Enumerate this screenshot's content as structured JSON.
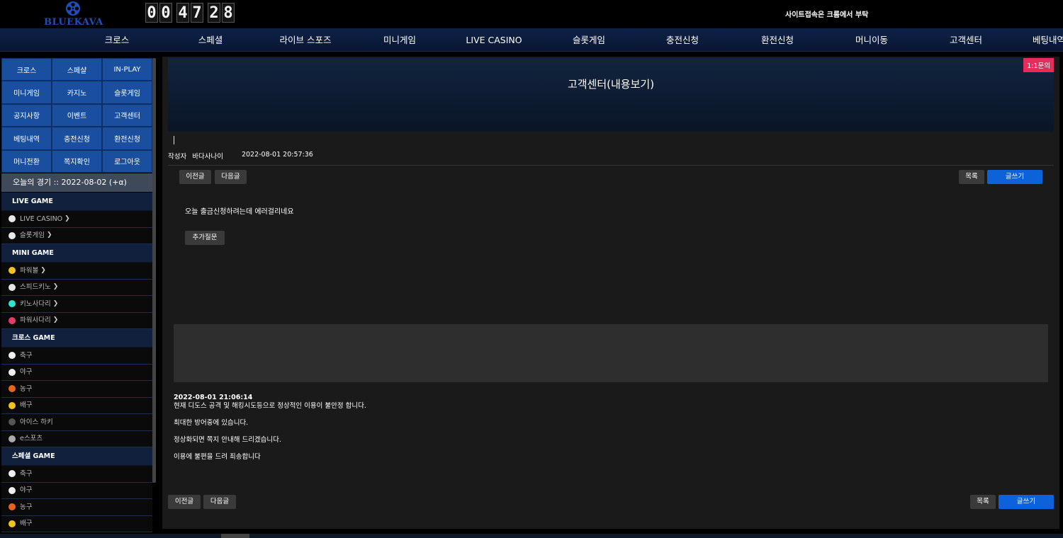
{
  "header": {
    "logo_text": "BLUEKAVA",
    "clock": {
      "hours": "00",
      "minutes": "47",
      "seconds": "28"
    },
    "ticker_text": "사이트접속은 크롬에서 부탁"
  },
  "nav": [
    "크로스",
    "스페셜",
    "라이브 스포즈",
    "미니게임",
    "LIVE CASINO",
    "슬롯게임",
    "충전신청",
    "환전신청",
    "머니이동",
    "고객센터",
    "베팅내역"
  ],
  "quick_menu": [
    "크로스",
    "스페샬",
    "IN-PLAY",
    "미니게임",
    "카지노",
    "슬롯게임",
    "공지사항",
    "이벤트",
    "고객센터",
    "베팅내역",
    "충전신청",
    "환전신청",
    "머니전환",
    "쪽지확인",
    "로그아웃"
  ],
  "today_match": "오늘의 경기 :: 2022-08-02 (+α)",
  "sidebar_sections": [
    {
      "header": "LIVE GAME",
      "items": [
        {
          "label": "LIVE CASINO",
          "icon": "casino-icon",
          "color": "#e9e9e9",
          "chevron": true
        },
        {
          "label": "슬롯게임",
          "icon": "slot-icon",
          "color": "#e9e9e9",
          "chevron": true
        }
      ]
    },
    {
      "header": "MINI GAME",
      "items": [
        {
          "label": "파워볼",
          "icon": "powerball-icon",
          "color": "#f2c31c",
          "chevron": true
        },
        {
          "label": "스피드키노",
          "icon": "speedkeno-icon",
          "color": "#e6e6e6",
          "chevron": true
        },
        {
          "label": "키노사다리",
          "icon": "kenoladder-icon",
          "color": "#2ee6c8",
          "chevron": true
        },
        {
          "label": "파워사다리",
          "icon": "powerladder-icon",
          "color": "#e63a6a",
          "chevron": true
        }
      ]
    },
    {
      "header": "크로스 GAME",
      "items": [
        {
          "label": "축구",
          "icon": "soccer-icon",
          "color": "#f0f0f0"
        },
        {
          "label": "야구",
          "icon": "baseball-icon",
          "color": "#f0f0f0"
        },
        {
          "label": "농구",
          "icon": "basketball-icon",
          "color": "#e8641c"
        },
        {
          "label": "배구",
          "icon": "volleyball-icon",
          "color": "#f2c31c"
        },
        {
          "label": "아이스 하키",
          "icon": "hockey-icon",
          "color": "#555555"
        },
        {
          "label": "e스포츠",
          "icon": "esports-icon",
          "color": "#aaaaaa"
        }
      ]
    },
    {
      "header": "스페셜 GAME",
      "items": [
        {
          "label": "축구",
          "icon": "soccer-icon",
          "color": "#f0f0f0"
        },
        {
          "label": "야구",
          "icon": "baseball-icon",
          "color": "#f0f0f0"
        },
        {
          "label": "농구",
          "icon": "basketball-icon",
          "color": "#e8641c"
        },
        {
          "label": "배구",
          "icon": "volleyball-icon",
          "color": "#f2c31c"
        }
      ]
    }
  ],
  "main": {
    "title": "고객센터(내용보기)",
    "qna_badge": "1:1문의",
    "author_label": "작성자",
    "author": "바다사나이",
    "posted_at": "2022-08-01 20:57:36",
    "prev_label": "이전글",
    "next_label": "다음글",
    "list_label": "목록",
    "write_label": "글쓰기",
    "content": "오늘 출금신청하려는데 에러걸리네요",
    "followup_label": "추가질문",
    "answer_date": "2022-08-01 21:06:14",
    "answer_lines": [
      "현재 디도스 공격 및 해킹시도등으로 정상적인 이용이 불안정 합니다.",
      "최대한 방어중에 있습니다.",
      "정상화되면 쪽지 안내해 드리겠습니다.",
      "이용에 불편을 드려 죄송합니다"
    ]
  },
  "colors": {
    "accent_blue": "#0d62d9",
    "badge_pink": "#e62c5d",
    "tile_blue": "#1a4f9f"
  }
}
